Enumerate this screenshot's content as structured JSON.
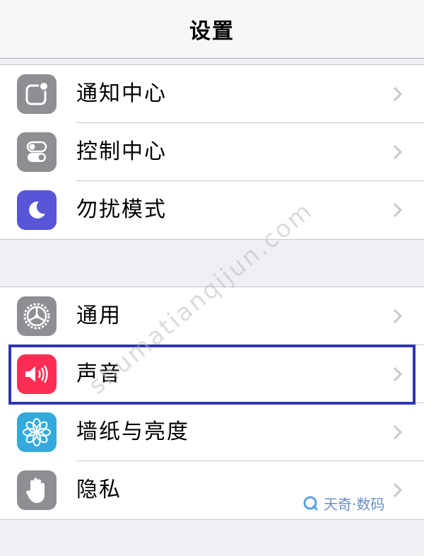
{
  "header": {
    "title": "设置"
  },
  "group1": {
    "items": [
      {
        "label": "通知中心",
        "icon": "notification-center-icon",
        "color": "#8e8e93"
      },
      {
        "label": "控制中心",
        "icon": "control-center-icon",
        "color": "#8e8e93"
      },
      {
        "label": "勿扰模式",
        "icon": "moon-icon",
        "color": "#5856d6"
      }
    ]
  },
  "group2": {
    "items": [
      {
        "label": "通用",
        "icon": "gear-icon",
        "color": "#8e8e93"
      },
      {
        "label": "声音",
        "icon": "speaker-icon",
        "color": "#ff2d55",
        "highlighted": true
      },
      {
        "label": "墙纸与亮度",
        "icon": "flower-icon",
        "color": "#34aadc"
      },
      {
        "label": "隐私",
        "icon": "hand-icon",
        "color": "#8e8e93"
      }
    ]
  },
  "watermark": {
    "diagonal": "shumatianqijun.com",
    "brand": "天奇·数码"
  }
}
